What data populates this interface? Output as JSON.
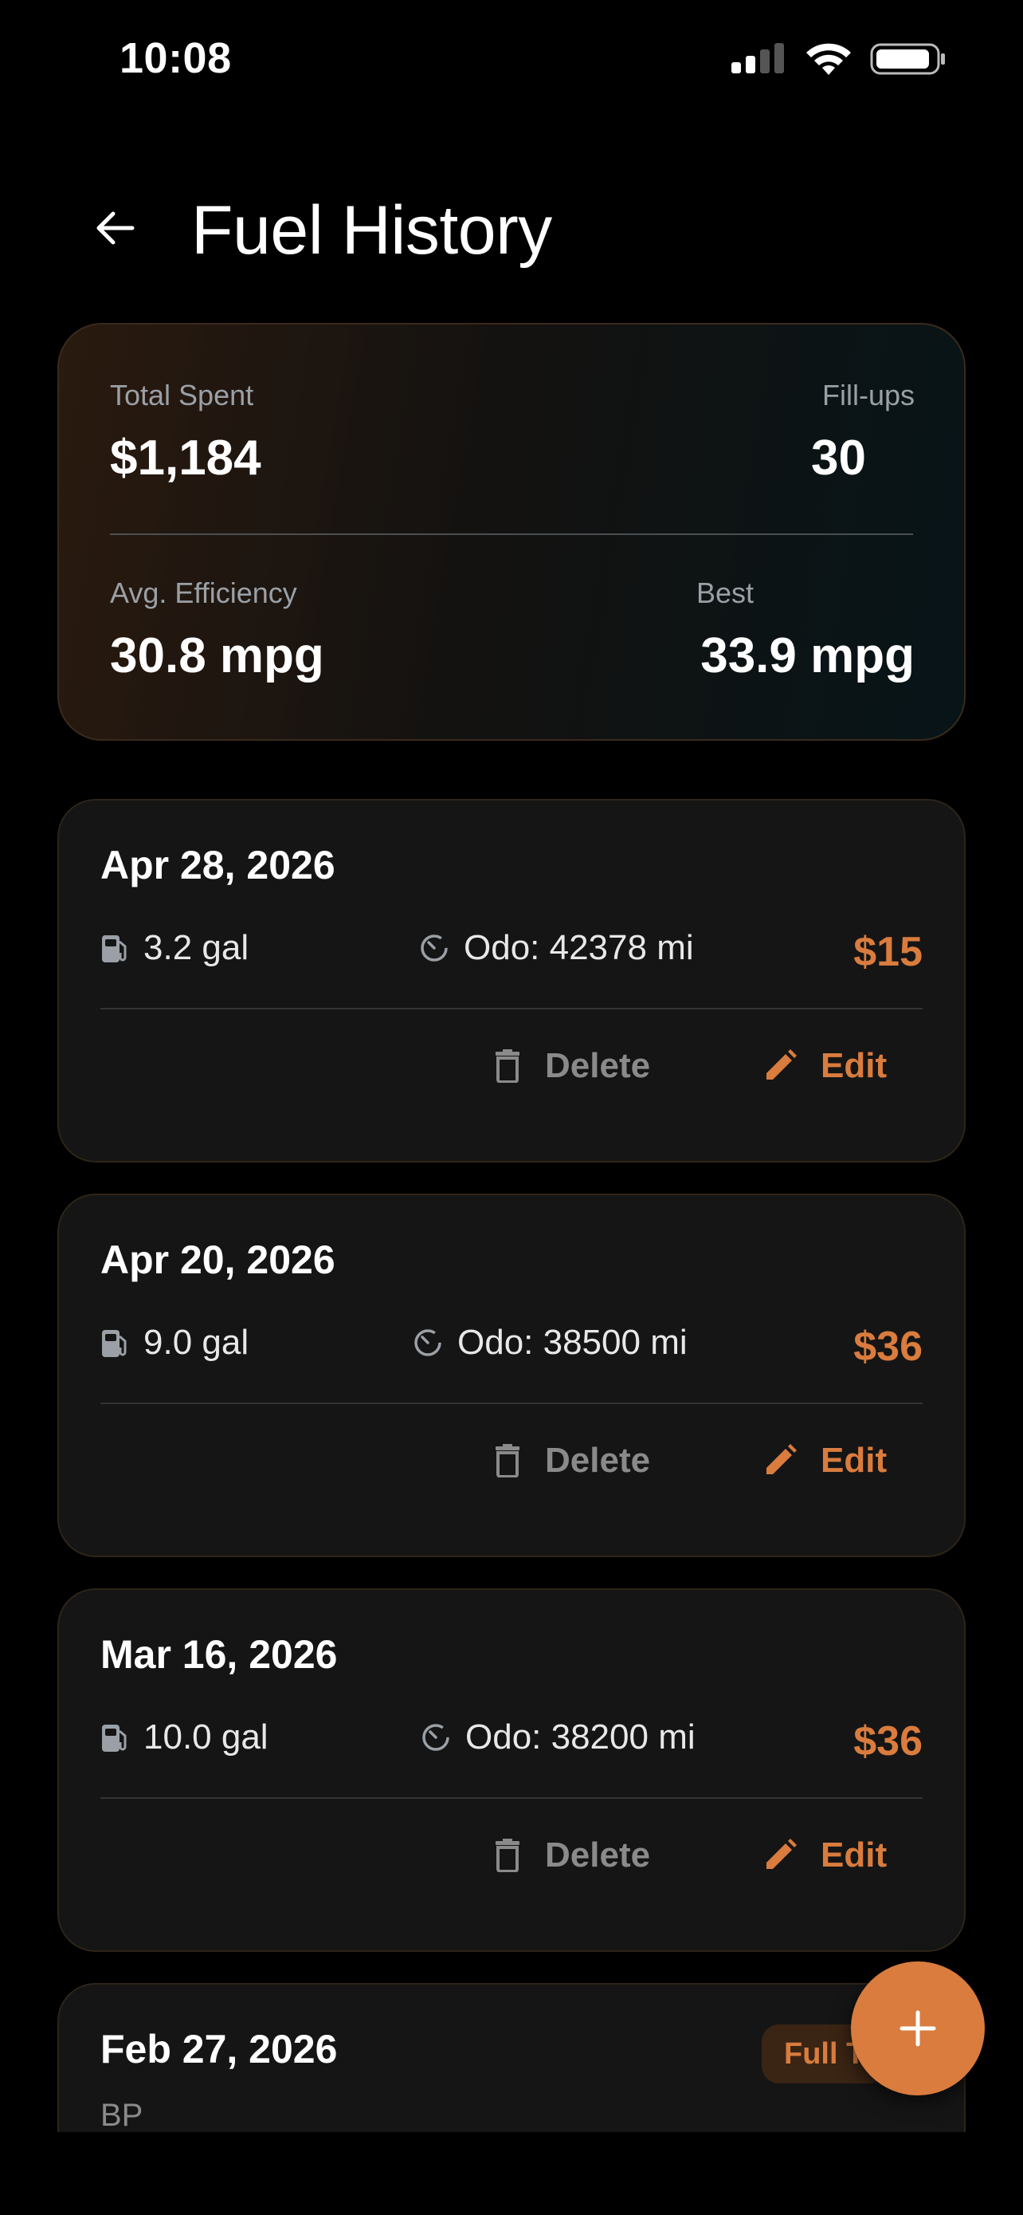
{
  "status_bar": {
    "time": "10:08"
  },
  "header": {
    "title": "Fuel History",
    "back_icon": "arrow-left-icon"
  },
  "summary": {
    "total_spent_label": "Total Spent",
    "total_spent_value": "$1,184",
    "fillups_label": "Fill-ups",
    "fillups_value": "30",
    "avg_eff_label": "Avg. Efficiency",
    "avg_eff_value": "30.8 mpg",
    "best_label": "Best",
    "best_value": "33.9 mpg"
  },
  "entries": [
    {
      "date": "Apr 28, 2026",
      "gallons": "3.2 gal",
      "odometer": "Odo: 42378 mi",
      "price": "$15",
      "delete_label": "Delete",
      "edit_label": "Edit"
    },
    {
      "date": "Apr 20, 2026",
      "gallons": "9.0 gal",
      "odometer": "Odo: 38500 mi",
      "price": "$36",
      "delete_label": "Delete",
      "edit_label": "Edit"
    },
    {
      "date": "Mar 16, 2026",
      "gallons": "10.0 gal",
      "odometer": "Odo: 38200 mi",
      "price": "$36",
      "delete_label": "Delete",
      "edit_label": "Edit"
    },
    {
      "date": "Feb 27, 2026",
      "station": "BP",
      "badge": "Full T"
    }
  ],
  "colors": {
    "accent": "#d97c3e",
    "background": "#000000",
    "card": "#151515",
    "muted": "#8a8a8a"
  },
  "fab": {
    "icon": "plus-icon"
  }
}
